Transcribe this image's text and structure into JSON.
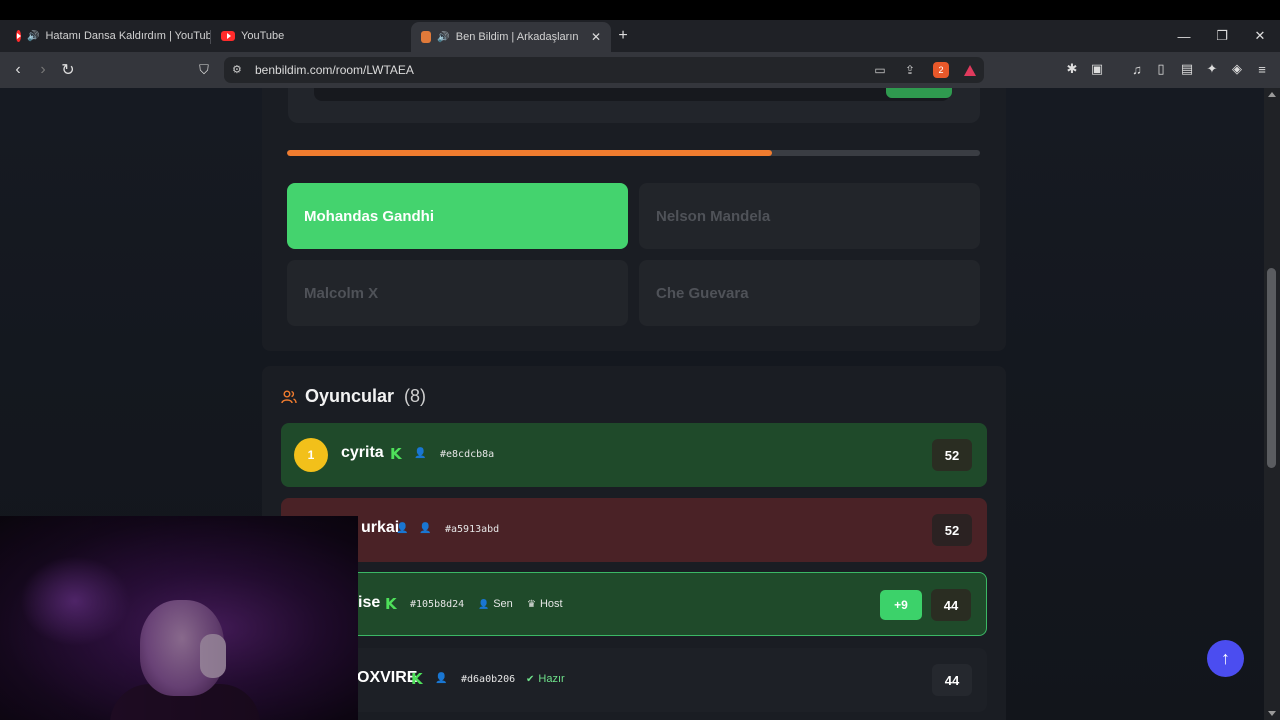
{
  "browser": {
    "tabs": [
      {
        "title": "Hatamı Dansa Kaldırdım | YouTub",
        "icon": "youtube-icon",
        "audio": true,
        "active": false
      },
      {
        "title": "YouTube",
        "icon": "youtube-icon",
        "audio": false,
        "active": false
      },
      {
        "title": "Ben Bildim | Arkadaşlarınla O",
        "icon": "benbildim-icon",
        "audio": true,
        "active": true
      }
    ],
    "url": "benbildim.com/room/LWTAEA",
    "brave_shield_count": "2"
  },
  "quiz": {
    "progress_percent": 70,
    "answers": [
      {
        "label": "Mohandas Gandhi",
        "correct": true
      },
      {
        "label": "Nelson Mandela",
        "correct": false
      },
      {
        "label": "Malcolm X",
        "correct": false
      },
      {
        "label": "Che Guevara",
        "correct": false
      }
    ]
  },
  "players": {
    "title": "Oyuncular",
    "count": "(8)",
    "rows": [
      {
        "rank": "1",
        "name": "cyrita",
        "id": "#e8cdcb8a",
        "score": "52"
      },
      {
        "name": "urkai",
        "id": "#a5913abd",
        "score": "52"
      },
      {
        "name": "ise",
        "id": "#105b8d24",
        "you_label": "Sen",
        "host_label": "Host",
        "gain": "+9",
        "score": "44"
      },
      {
        "name": "OXVIRE",
        "id": "#d6a0b206",
        "ready_label": "Hazır",
        "score": "44"
      }
    ]
  },
  "colors": {
    "accent_orange": "#f07c2f",
    "correct_green": "#44d36e",
    "fab_blue": "#4b4df0"
  }
}
